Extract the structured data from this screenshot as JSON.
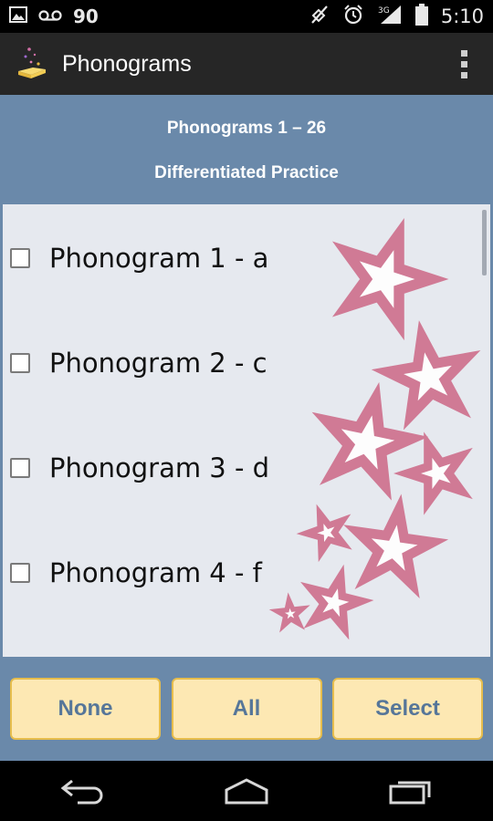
{
  "status_bar": {
    "left_icons": [
      "image-icon",
      "voicemail-icon"
    ],
    "notification_count": "90",
    "right_icons": [
      "mute-icon",
      "alarm-icon",
      "signal-3g-icon",
      "battery-icon"
    ],
    "network_label": "3G",
    "time": "5:10"
  },
  "action_bar": {
    "app_icon": "book-sparkle-icon",
    "title": "Phonograms",
    "menu_icon": "overflow-menu-icon"
  },
  "header": {
    "title": "Phonograms 1 – 26",
    "subtitle": "Differentiated Practice"
  },
  "list": {
    "items": [
      {
        "label": "Phonogram 1 - a",
        "checked": false
      },
      {
        "label": "Phonogram 2 - c",
        "checked": false
      },
      {
        "label": "Phonogram 3 - d",
        "checked": false
      },
      {
        "label": "Phonogram 4 - f",
        "checked": false
      }
    ],
    "decoration": "pink-stars"
  },
  "buttons": {
    "none_label": "None",
    "all_label": "All",
    "select_label": "Select"
  },
  "nav_bar": {
    "icons": [
      "back-icon",
      "home-icon",
      "recents-icon"
    ]
  },
  "colors": {
    "accent_blue": "#6a89aa",
    "list_background": "#e6e9ef",
    "button_fill": "#fde8b3",
    "button_border": "#e6bd4d",
    "button_text": "#567699",
    "star_pink": "#d07a95"
  }
}
